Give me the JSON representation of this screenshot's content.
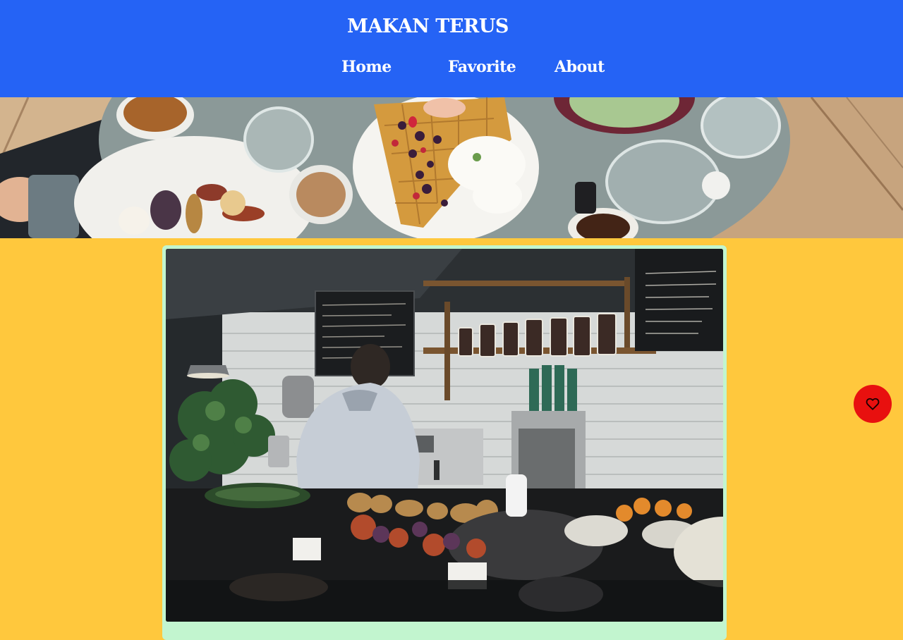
{
  "header": {
    "brand": "MAKAN TERUS",
    "nav": [
      {
        "label": "Home"
      },
      {
        "label": "Favorite"
      },
      {
        "label": "About"
      }
    ]
  },
  "hero": {
    "image_icon": "food-table-photo"
  },
  "card": {
    "image_icon": "cafe-counter-photo"
  },
  "fab": {
    "icon": "heart-outline-icon"
  },
  "colors": {
    "header_bg": "#2563f5",
    "page_bg": "#ffc83d",
    "card_bg": "#c2f5cf",
    "fab_bg": "#e8100f",
    "text_on_header": "#ffffff"
  }
}
